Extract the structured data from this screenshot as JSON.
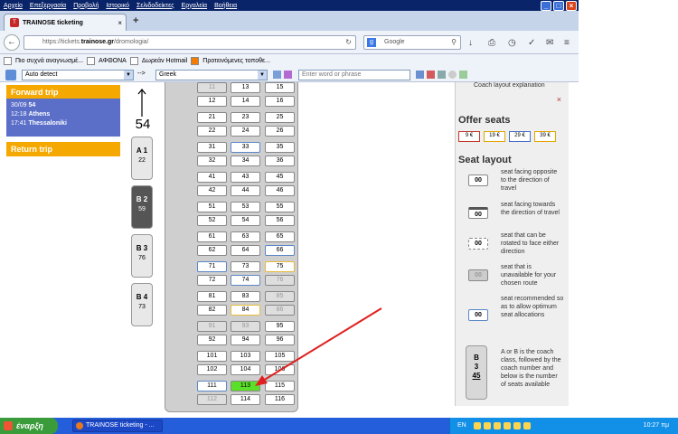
{
  "menu": [
    "Αρχείο",
    "Επεξεργασία",
    "Προβολή",
    "Ιστορικό",
    "Σελιδοδείκτες",
    "Εργαλεία",
    "Βοήθεια"
  ],
  "tab": {
    "title": "TRAINOSE ticketing",
    "close": "×",
    "new": "+"
  },
  "nav": {
    "url_prefix": "https://tickets.",
    "url_domain": "trainose.gr",
    "url_path": "/dromologia/",
    "search_placeholder": "Google"
  },
  "bookmarks": [
    "Πιο συχνά αναγνωσμέ...",
    "ΑΦΘΟΝΑ",
    "Δωρεάν Hotmail",
    "Προτεινόμενες τοποθε..."
  ],
  "translate": {
    "source": "Auto detect",
    "arrow": "-->",
    "target": "Greek",
    "placeholder": "Enter word or phrase"
  },
  "forward": {
    "title": "Forward trip",
    "date": "30/09",
    "train": "54",
    "dep_time": "12:18",
    "dep_station": "Athens",
    "arr_time": "17:41",
    "arr_station": "Thessaloniki"
  },
  "return": {
    "title": "Return trip"
  },
  "train_number": "54",
  "coaches": [
    {
      "label": "A 1",
      "seats": "22",
      "active": false
    },
    {
      "label": "B 2",
      "seats": "59",
      "active": true
    },
    {
      "label": "B 3",
      "seats": "76",
      "active": false
    },
    {
      "label": "B 4",
      "seats": "73",
      "active": false
    }
  ],
  "seats": [
    [
      "11",
      "u"
    ],
    [
      "13",
      ""
    ],
    [
      "15",
      ""
    ],
    [
      "12",
      ""
    ],
    [
      "14",
      ""
    ],
    [
      "16",
      ""
    ],
    [
      "21",
      ""
    ],
    [
      "23",
      ""
    ],
    [
      "25",
      ""
    ],
    [
      "22",
      ""
    ],
    [
      "24",
      ""
    ],
    [
      "26",
      ""
    ],
    [
      "31",
      ""
    ],
    [
      "33",
      "b"
    ],
    [
      "35",
      ""
    ],
    [
      "32",
      ""
    ],
    [
      "34",
      ""
    ],
    [
      "36",
      ""
    ],
    [
      "41",
      ""
    ],
    [
      "43",
      ""
    ],
    [
      "45",
      ""
    ],
    [
      "42",
      ""
    ],
    [
      "44",
      ""
    ],
    [
      "46",
      ""
    ],
    [
      "51",
      ""
    ],
    [
      "53",
      ""
    ],
    [
      "55",
      ""
    ],
    [
      "52",
      ""
    ],
    [
      "54",
      ""
    ],
    [
      "56",
      ""
    ],
    [
      "61",
      ""
    ],
    [
      "63",
      ""
    ],
    [
      "65",
      ""
    ],
    [
      "62",
      ""
    ],
    [
      "64",
      ""
    ],
    [
      "66",
      "b"
    ],
    [
      "71",
      "b"
    ],
    [
      "73",
      ""
    ],
    [
      "75",
      "y"
    ],
    [
      "72",
      ""
    ],
    [
      "74",
      "b"
    ],
    [
      "76",
      "u"
    ],
    [
      "81",
      ""
    ],
    [
      "83",
      ""
    ],
    [
      "85",
      "u"
    ],
    [
      "82",
      ""
    ],
    [
      "84",
      "y"
    ],
    [
      "86",
      "u"
    ],
    [
      "91",
      "u"
    ],
    [
      "93",
      "u"
    ],
    [
      "95",
      ""
    ],
    [
      "92",
      ""
    ],
    [
      "94",
      ""
    ],
    [
      "96",
      ""
    ],
    [
      "101",
      ""
    ],
    [
      "103",
      ""
    ],
    [
      "105",
      ""
    ],
    [
      "102",
      ""
    ],
    [
      "104",
      ""
    ],
    [
      "106",
      ""
    ],
    [
      "111",
      "b"
    ],
    [
      "113",
      "g"
    ],
    [
      "115",
      ""
    ],
    [
      "112",
      "u"
    ],
    [
      "114",
      ""
    ],
    [
      "116",
      ""
    ]
  ],
  "side": {
    "top_label": "Coach layout explanation",
    "close": "×",
    "offer_title": "Offer seats",
    "prices": [
      "9 €",
      "19 €",
      "29 €",
      "39 €"
    ],
    "price_colors": [
      "#c0392b",
      "#e0a800",
      "#4a6fc7",
      "#e0a800"
    ],
    "layout_title": "Seat layout",
    "legend": [
      {
        "seat": "00",
        "text": "seat facing opposite to the direction of travel"
      },
      {
        "seat": "00",
        "text": "seat facing towards the direction of travel"
      },
      {
        "seat": "00",
        "text": "seat that can be rotated to face either direction"
      },
      {
        "seat": "00",
        "text": "seat that is unavailable for your chosen route"
      },
      {
        "seat": "00",
        "text": "seat recommended so as to allow optimum seat allocations"
      }
    ],
    "coach_example": {
      "cls": "B",
      "num": "3",
      "seats": "45"
    },
    "coach_text": "A or B is the coach class, followed by the coach number and below is the number of seats available"
  },
  "taskbar": {
    "start": "έναρξη",
    "task": "TRAINOSE ticketing - ...",
    "lang": "EN",
    "clock": "10:27 πμ"
  }
}
